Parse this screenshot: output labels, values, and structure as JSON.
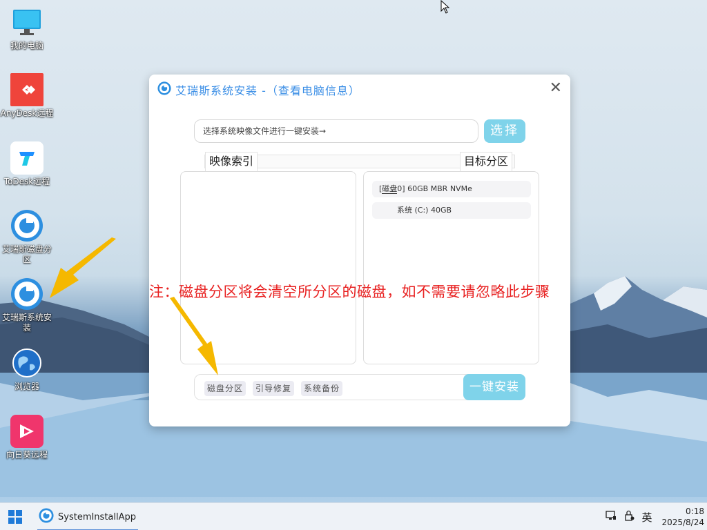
{
  "desktop": {
    "icons": [
      {
        "label": "我的电脑",
        "icon": "monitor-icon"
      },
      {
        "label": "AnyDesk远程",
        "icon": "anydesk-icon"
      },
      {
        "label": "ToDesk远程",
        "icon": "todesk-icon"
      },
      {
        "label": "艾瑞斯磁盘分区",
        "icon": "iris-partition-icon"
      },
      {
        "label": "艾瑞斯系统安装",
        "icon": "iris-install-icon"
      },
      {
        "label": "浏览器",
        "icon": "globe-icon"
      },
      {
        "label": "向日葵远程",
        "icon": "sunflower-icon"
      }
    ]
  },
  "window": {
    "title": "艾瑞斯系统安装 -（查看电脑信息）",
    "close_label": "✕",
    "file_input_placeholder": "选择系统映像文件进行一键安装→",
    "select_button": "选择",
    "image_index_tab": "映像索引",
    "target_partition_tab": "目标分区",
    "disk_header": "[磁盘0]  60GB  MBR  NVMe",
    "disk_header_parts": {
      "prefix": "[",
      "disk": "磁盘",
      "rest": "0]  60GB  MBR  NVMe"
    },
    "partition_row": "系统 (C:) 40GB",
    "tools": [
      "磁盘分区",
      "引导修复",
      "系统备份"
    ],
    "install_button": "一键安装"
  },
  "note": "注：磁盘分区将会清空所分区的磁盘，如不需要请忽略此步骤",
  "taskbar": {
    "app_name": "SystemInstallApp",
    "ime": "英",
    "time": "0:18",
    "date": "2025/8/24"
  },
  "colors": {
    "accent": "#7fd3ea",
    "title_blue": "#3a8ee6",
    "note_red": "#e82121",
    "arrow_orange": "#f5b800"
  }
}
